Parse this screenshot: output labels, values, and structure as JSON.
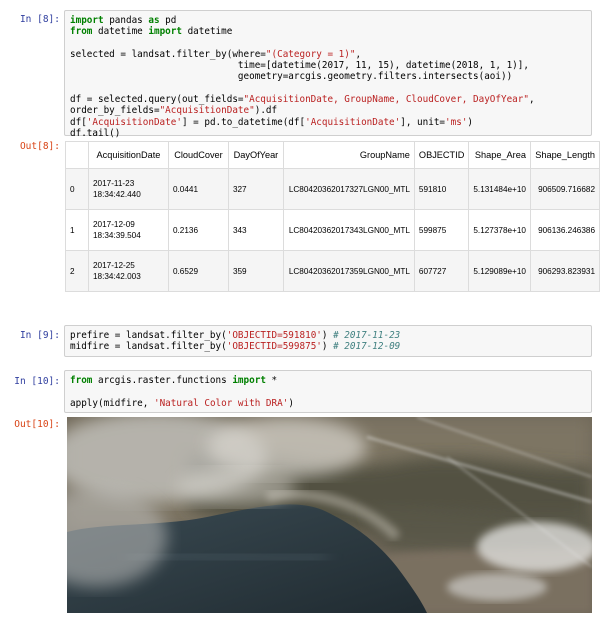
{
  "cell8": {
    "in_prompt": "In [8]:",
    "out_prompt": "Out[8]:",
    "code_lines": [
      [
        {
          "t": "import",
          "c": "kw"
        },
        {
          "t": " pandas "
        },
        {
          "t": "as",
          "c": "kw"
        },
        {
          "t": " pd"
        }
      ],
      [
        {
          "t": "from",
          "c": "kw"
        },
        {
          "t": " datetime "
        },
        {
          "t": "import",
          "c": "kw"
        },
        {
          "t": " datetime"
        }
      ],
      [],
      [
        {
          "t": "selected = landsat.filter_by(where="
        },
        {
          "t": "\"(Category = 1)\"",
          "c": "str"
        },
        {
          "t": ","
        }
      ],
      [
        {
          "t": "                              time=[datetime(2017, 11, 15), datetime(2018, 1, 1)],"
        }
      ],
      [
        {
          "t": "                              geometry=arcgis.geometry.filters.intersects(aoi))"
        }
      ],
      [],
      [
        {
          "t": "df = selected.query(out_fields="
        },
        {
          "t": "\"AcquisitionDate, GroupName, CloudCover, DayOfYear\"",
          "c": "str"
        },
        {
          "t": ","
        }
      ],
      [
        {
          "t": "order_by_fields="
        },
        {
          "t": "\"AcquisitionDate\"",
          "c": "str"
        },
        {
          "t": ").df"
        }
      ],
      [
        {
          "t": "df["
        },
        {
          "t": "'AcquisitionDate'",
          "c": "str"
        },
        {
          "t": "] = pd.to_datetime(df["
        },
        {
          "t": "'AcquisitionDate'",
          "c": "str"
        },
        {
          "t": "], unit="
        },
        {
          "t": "'ms'",
          "c": "str"
        },
        {
          "t": ")"
        }
      ],
      [
        {
          "t": "df.tail()"
        }
      ]
    ],
    "table": {
      "columns": [
        "",
        "AcquisitionDate",
        "CloudCover",
        "DayOfYear",
        "GroupName",
        "OBJECTID",
        "Shape_Area",
        "Shape_Length"
      ],
      "rows": [
        {
          "index": "0",
          "date": "2017-11-23",
          "time": "18:34:42.440",
          "cloud": "0.0441",
          "doy": "327",
          "group": "LC80420362017327LGN00_MTL",
          "oid": "591810",
          "area": "5.131484e+10",
          "length": "906509.716682"
        },
        {
          "index": "1",
          "date": "2017-12-09",
          "time": "18:34:39.504",
          "cloud": "0.2136",
          "doy": "343",
          "group": "LC80420362017343LGN00_MTL",
          "oid": "599875",
          "area": "5.127378e+10",
          "length": "906136.246386"
        },
        {
          "index": "2",
          "date": "2017-12-25",
          "time": "18:34:42.003",
          "cloud": "0.6529",
          "doy": "359",
          "group": "LC80420362017359LGN00_MTL",
          "oid": "607727",
          "area": "5.129089e+10",
          "length": "906293.823931"
        }
      ]
    }
  },
  "cell9": {
    "in_prompt": "In [9]:",
    "code_lines": [
      [
        {
          "t": "prefire = landsat.filter_by("
        },
        {
          "t": "'OBJECTID=591810'",
          "c": "str"
        },
        {
          "t": ") "
        },
        {
          "t": "# 2017-11-23",
          "c": "cm"
        }
      ],
      [
        {
          "t": "midfire = landsat.filter_by("
        },
        {
          "t": "'OBJECTID=599875'",
          "c": "str"
        },
        {
          "t": ") "
        },
        {
          "t": "# 2017-12-09",
          "c": "cm"
        }
      ]
    ]
  },
  "cell10": {
    "in_prompt": "In [10]:",
    "out_prompt": "Out[10]:",
    "code_lines": [
      [
        {
          "t": "from",
          "c": "kw"
        },
        {
          "t": " arcgis.raster.functions "
        },
        {
          "t": "import",
          "c": "kw"
        },
        {
          "t": " *"
        }
      ],
      [],
      [
        {
          "t": "apply(midfire, "
        },
        {
          "t": "'Natural Color with DRA'",
          "c": "str"
        },
        {
          "t": ")"
        }
      ]
    ]
  },
  "colors": {
    "in_prompt": "#303f9f",
    "out_prompt": "#d84315",
    "keyword": "#008000",
    "string": "#ba2121",
    "comment": "#408080",
    "code_background": "#f7f7f7"
  }
}
